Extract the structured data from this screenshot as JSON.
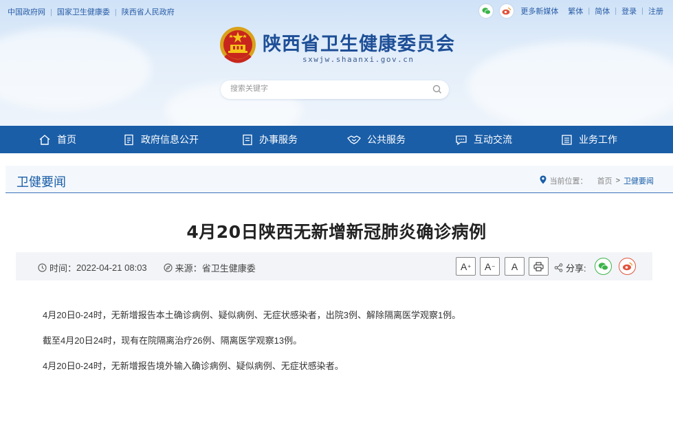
{
  "top_links": [
    "中国政府网",
    "国家卫生健康委",
    "陕西省人民政府"
  ],
  "top_right": {
    "icons": [
      "wechat-icon",
      "weibo-icon"
    ],
    "more_media": "更多新媒体",
    "links": [
      "繁体",
      "简体",
      "登录",
      "注册"
    ]
  },
  "site": {
    "title": "陕西省卫生健康委员会",
    "domain": "sxwjw.shaanxi.gov.cn"
  },
  "search": {
    "placeholder": "搜索关键字"
  },
  "nav": [
    {
      "label": "首页",
      "icon": "home-icon"
    },
    {
      "label": "政府信息公开",
      "icon": "document-icon"
    },
    {
      "label": "办事服务",
      "icon": "clipboard-icon"
    },
    {
      "label": "公共服务",
      "icon": "handshake-icon"
    },
    {
      "label": "互动交流",
      "icon": "chat-icon"
    },
    {
      "label": "业务工作",
      "icon": "briefcase-icon"
    }
  ],
  "section": {
    "title": "卫健要闻",
    "breadcrumb_label": "当前位置：",
    "breadcrumb_home": "首页",
    "breadcrumb_sep": ">",
    "breadcrumb_current": "卫健要闻"
  },
  "article": {
    "title": "4月20日陕西无新增新冠肺炎确诊病例",
    "time_label": "时间：",
    "time": "2022-04-21 08:03",
    "source_label": "来源：",
    "source": "省卫生健康委",
    "font_buttons": [
      "A",
      "A",
      "A"
    ],
    "share_label": "分享:",
    "paragraphs": [
      "4月20日0-24时，无新增报告本土确诊病例、疑似病例、无症状感染者，出院3例、解除隔离医学观察1例。",
      "截至4月20日24时，现有在院隔离治疗26例、隔离医学观察13例。",
      "4月20日0-24时，无新增报告境外输入确诊病例、疑似病例、无症状感染者。"
    ]
  },
  "colors": {
    "brand_blue": "#1a5ea8",
    "wechat_green": "#3bb44a",
    "weibo_red": "#e2533c"
  }
}
